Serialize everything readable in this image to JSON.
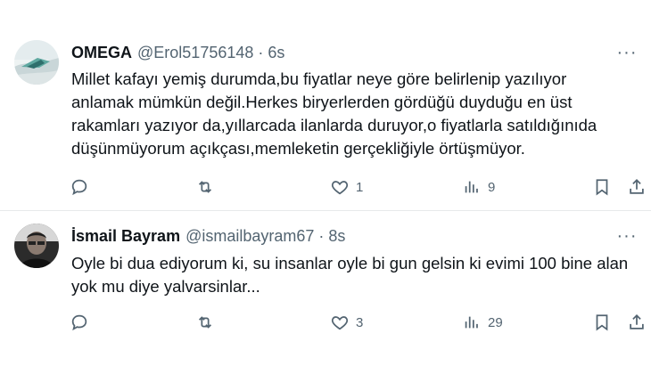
{
  "tweets": [
    {
      "name": "OMEGA",
      "handle": "@Erol51756148",
      "separator": "·",
      "time": "6s",
      "text_lines": [
        "Millet kafayı yemiş durumda,bu fiyatlar neye göre belirlenip yazılıyor",
        "anlamak mümkün değil.Herkes biryerlerden gördüğü duyduğu en üst",
        "rakamları yazıyor da,yıllarcada ilanlarda duruyor,o fiyatlarla satıldığınıda",
        "düşünmüyorum açıkçası,memleketin gerçekliğiyle örtüşmüyor."
      ],
      "reply_count": "",
      "retweet_count": "",
      "like_count": "1",
      "view_count": "9",
      "avatar_icon": "landscape-photo-avatar"
    },
    {
      "name": "İsmail Bayram",
      "handle": "@ismailbayram67",
      "separator": "·",
      "time": "8s",
      "text_lines": [
        "Oyle bi dua ediyorum ki, su insanlar oyle bi gun gelsin ki evimi 100 bine alan",
        "yok mu diye yalvarsinlar..."
      ],
      "reply_count": "",
      "retweet_count": "",
      "like_count": "3",
      "view_count": "29",
      "avatar_icon": "person-photo-avatar"
    }
  ],
  "more_icon": "···",
  "colors": {
    "text": "#0f1419",
    "secondary": "#536471",
    "divider": "#e7e9ea"
  }
}
